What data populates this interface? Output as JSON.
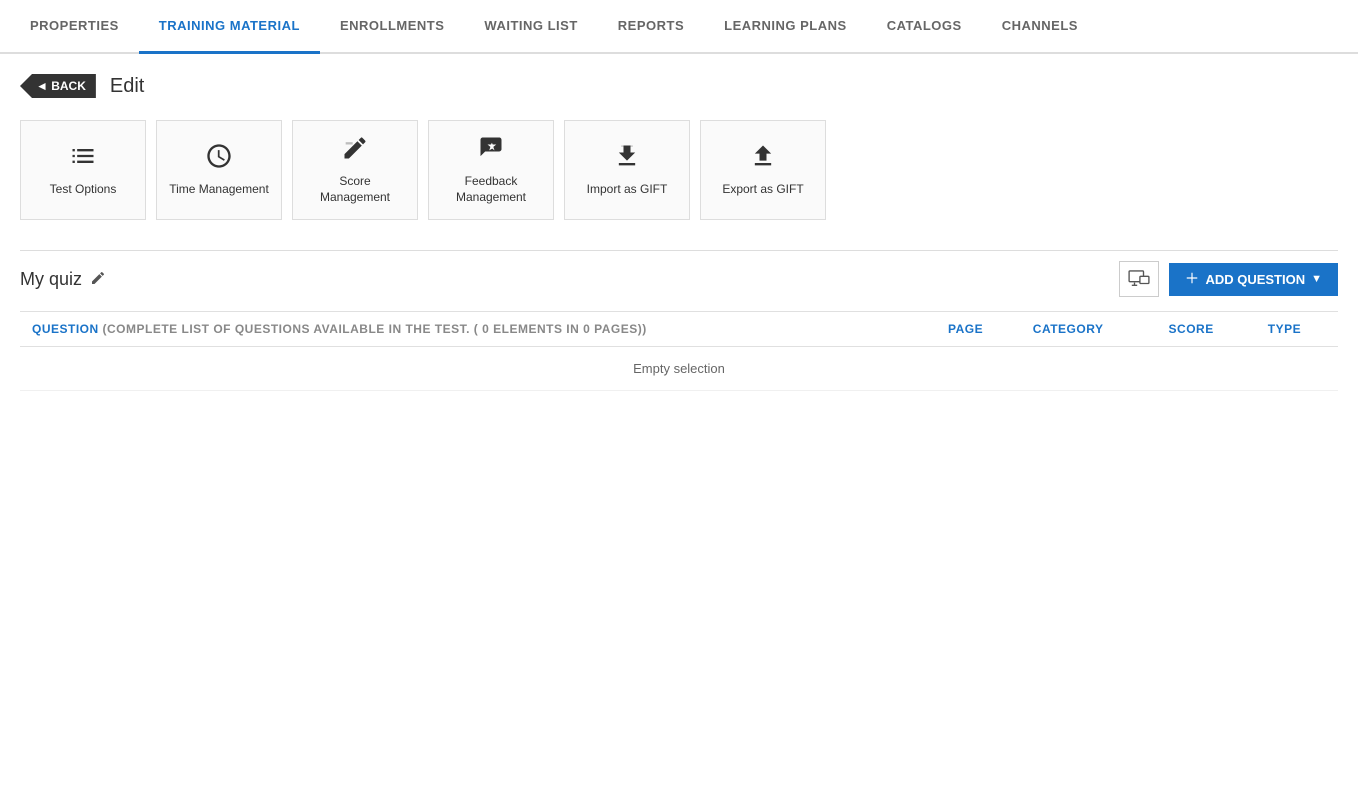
{
  "nav": {
    "tabs": [
      {
        "id": "properties",
        "label": "PROPERTIES",
        "active": false
      },
      {
        "id": "training-material",
        "label": "TRAINING MATERIAL",
        "active": true
      },
      {
        "id": "enrollments",
        "label": "ENROLLMENTS",
        "active": false
      },
      {
        "id": "waiting-list",
        "label": "WAITING LIST",
        "active": false
      },
      {
        "id": "reports",
        "label": "REPORTS",
        "active": false
      },
      {
        "id": "learning-plans",
        "label": "LEARNING PLANS",
        "active": false
      },
      {
        "id": "catalogs",
        "label": "CATALOGS",
        "active": false
      },
      {
        "id": "channels",
        "label": "CHANNELS",
        "active": false
      }
    ]
  },
  "header": {
    "back_label": "◄ BACK",
    "edit_label": "Edit"
  },
  "tool_cards": [
    {
      "id": "test-options",
      "label": "Test Options",
      "icon": "list"
    },
    {
      "id": "time-management",
      "label": "Time Management",
      "icon": "clock"
    },
    {
      "id": "score-management",
      "label": "Score Management",
      "icon": "edit-check"
    },
    {
      "id": "feedback-management",
      "label": "Feedback Management",
      "icon": "check-edit"
    },
    {
      "id": "import-gift",
      "label": "Import as GIFT",
      "icon": "import"
    },
    {
      "id": "export-gift",
      "label": "Export as GIFT",
      "icon": "export"
    }
  ],
  "quiz": {
    "title": "My quiz",
    "add_question_label": "ADD QUESTION"
  },
  "table": {
    "columns": [
      {
        "id": "question",
        "label": "QUESTION",
        "meta": "(Complete list of questions available in the test. ( 0 elements in 0 pages))"
      },
      {
        "id": "page",
        "label": "PAGE"
      },
      {
        "id": "category",
        "label": "CATEGORY"
      },
      {
        "id": "score",
        "label": "SCORE"
      },
      {
        "id": "type",
        "label": "TYPE"
      }
    ],
    "empty_label": "Empty selection"
  }
}
